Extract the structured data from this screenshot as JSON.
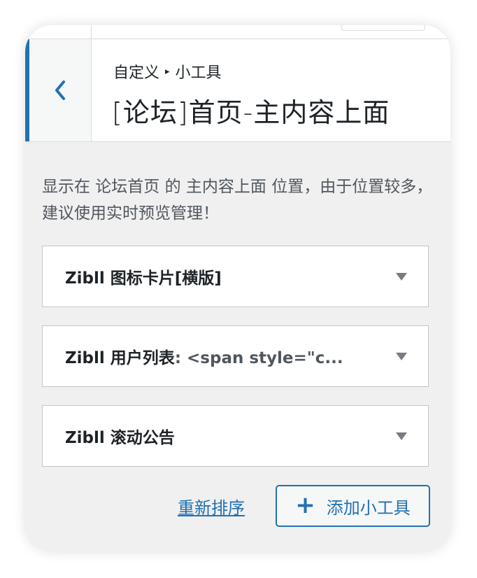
{
  "header": {
    "breadcrumb_root": "自定义",
    "breadcrumb_current": "小工具",
    "title": "[论坛]首页-主内容上面"
  },
  "description": "显示在 论坛首页 的 主内容上面 位置，由于位置较多，建议使用实时预览管理！",
  "widgets": [
    {
      "title": "Zibll 图标卡片[横版]",
      "subtitle": ""
    },
    {
      "title": "Zibll 用户列表",
      "subtitle": ": <span style=\"c..."
    },
    {
      "title": "Zibll 滚动公告",
      "subtitle": ""
    }
  ],
  "actions": {
    "reorder_label": "重新排序",
    "add_label": "添加小工具",
    "add_icon": "+"
  },
  "colors": {
    "accent": "#2271b1",
    "background": "#f0f0f1",
    "text": "#1d2327"
  }
}
